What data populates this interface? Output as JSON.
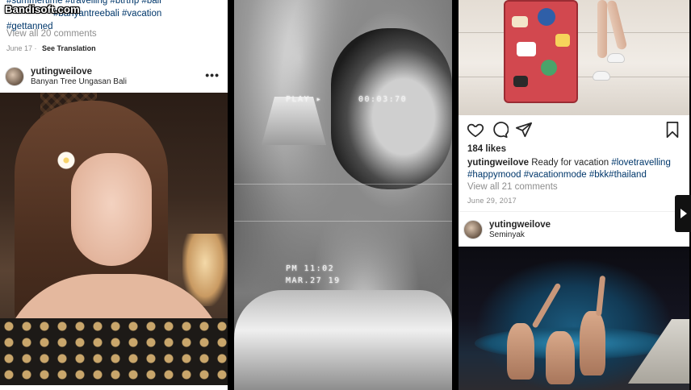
{
  "watermark": "Bandisoft.com",
  "left_post": {
    "caption_line1": "#summertime #travelling #btrtrip #bali",
    "caption_line2_tags": "#banyantreebali #vacation",
    "caption_line3": "#gettanned",
    "view_comments": "View all 20 comments",
    "date": "June 17",
    "see_translation": "See Translation"
  },
  "left_next_post": {
    "username": "yutingweilove",
    "location": "Banyan Tree Ungasan Bali",
    "more": "•••"
  },
  "video": {
    "play": "PLAY ▸",
    "timer": "00:03:70",
    "time": "PM 11:02",
    "date": "MAR.27 19"
  },
  "right_post": {
    "likes": "184 likes",
    "username": "yutingweilove",
    "caption_text": " Ready for vacation ",
    "caption_tag1": "#lovetravelling",
    "caption_tags2": "#happymood #vacationmode #bkk#thailand",
    "view_comments": "View all 21 comments",
    "date": "June 29, 2017"
  },
  "right_next_post": {
    "username": "yutingweilove",
    "location": "Seminyak",
    "more": "••"
  },
  "icons": [
    "heart-icon",
    "comment-icon",
    "share-icon",
    "bookmark-icon",
    "chevron-right-icon"
  ],
  "colors": {
    "hashtag": "#00376b",
    "muted": "#8e8e8e",
    "text": "#262626",
    "suitcase": "#d2484f"
  }
}
